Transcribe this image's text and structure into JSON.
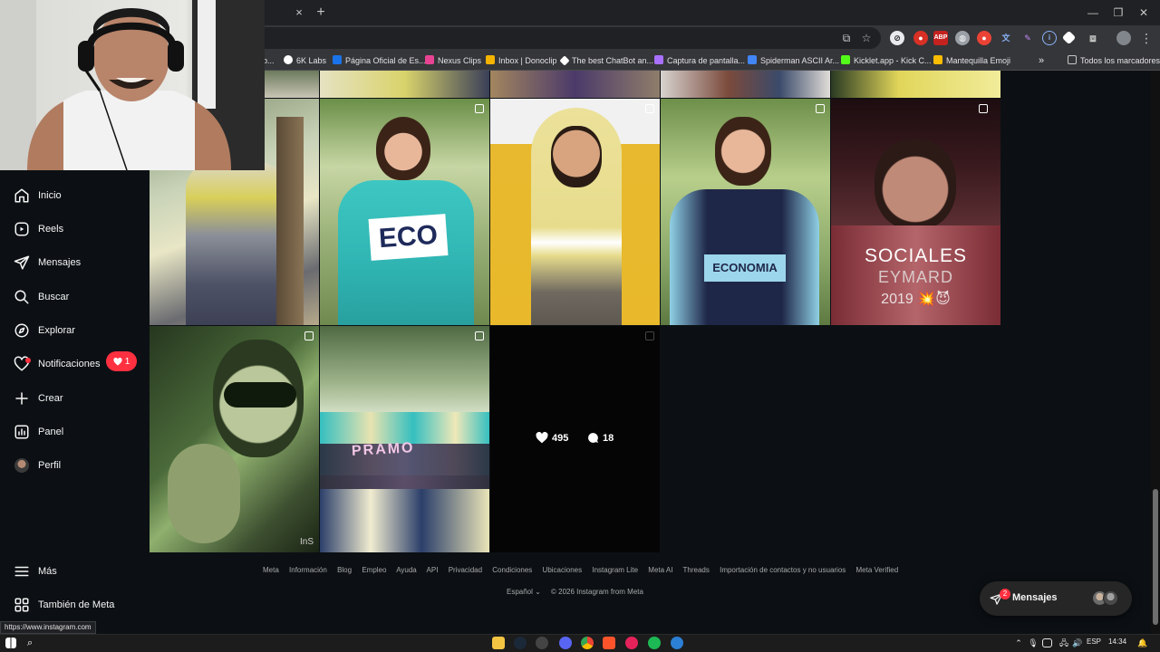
{
  "browser": {
    "new_tab": "+",
    "tab_close": "×",
    "window_controls": [
      "—",
      "❐",
      "✕"
    ],
    "bookmarks": [
      {
        "label": "b...",
        "color": "#5f6368"
      },
      {
        "label": "6K Labs",
        "color": "#ffffff"
      },
      {
        "label": "Página Oficial de Es...",
        "color": "#1a73e8"
      },
      {
        "label": "Nexus Clips",
        "color": "#e84393"
      },
      {
        "label": "Inbox | Donoclip",
        "color": "#f4b400"
      },
      {
        "label": "The best ChatBot an...",
        "color": "#ffffff"
      },
      {
        "label": "Captura de pantalla...",
        "color": "#a970ff"
      },
      {
        "label": "Spiderman ASCII Ar...",
        "color": "#4285f4"
      },
      {
        "label": "Kicklet.app - Kick C...",
        "color": "#53fc18"
      },
      {
        "label": "Mantequilla Emoji",
        "color": "#fbbc04"
      }
    ],
    "bookmarks_overflow": "»",
    "all_bookmarks": "Todos los marcadores",
    "status_url": "https://www.instagram.com"
  },
  "sidebar": {
    "items": [
      {
        "label": "Inicio",
        "icon": "home-icon"
      },
      {
        "label": "Reels",
        "icon": "reels-icon"
      },
      {
        "label": "Mensajes",
        "icon": "messages-icon"
      },
      {
        "label": "Buscar",
        "icon": "search-icon"
      },
      {
        "label": "Explorar",
        "icon": "explore-icon"
      },
      {
        "label": "Notificaciones",
        "icon": "heart-icon"
      },
      {
        "label": "Crear",
        "icon": "plus-icon"
      },
      {
        "label": "Panel",
        "icon": "chart-icon"
      },
      {
        "label": "Perfil",
        "icon": "avatar"
      }
    ],
    "more": "Más",
    "meta": "También de Meta",
    "notif_count": "1"
  },
  "grid": {
    "tile_sociales_title": "SOCIALES",
    "tile_sociales_subtitle": "EYMARD",
    "tile_sociales_year": "2019 💥😈",
    "hover_likes": "495",
    "hover_comments": "18",
    "jacket_text_1": "ECO",
    "jacket_text_2": "ECONOMIA",
    "banner_text": "PRAMO",
    "watermark": "InS"
  },
  "footer": {
    "links": [
      "Meta",
      "Información",
      "Blog",
      "Empleo",
      "Ayuda",
      "API",
      "Privacidad",
      "Condiciones",
      "Ubicaciones",
      "Instagram Lite",
      "Meta AI",
      "Threads",
      "Importación de contactos y no usuarios",
      "Meta Verified"
    ],
    "language": "Español",
    "copyright": "© 2026 Instagram from Meta"
  },
  "messages_pill": {
    "label": "Mensajes",
    "badge": "2"
  },
  "taskbar": {
    "lang": "ESP",
    "time": "14:34"
  },
  "colors": {
    "page_bg": "#0c1014",
    "accent_red": "#ff3040"
  }
}
